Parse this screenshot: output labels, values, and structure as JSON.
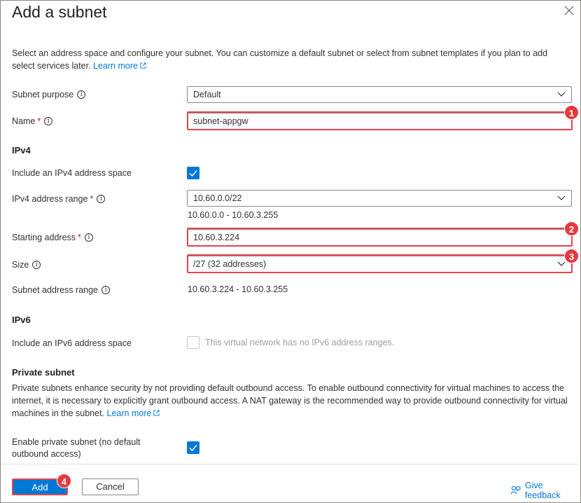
{
  "dialog": {
    "title": "Add a subnet",
    "description": "Select an address space and configure your subnet. You can customize a default subnet or select from subnet templates if you plan to add select services later.",
    "learn_more": "Learn more"
  },
  "form": {
    "subnet_purpose": {
      "label": "Subnet purpose",
      "value": "Default"
    },
    "name": {
      "label": "Name",
      "required_mark": "*",
      "value": "subnet-appgw"
    },
    "ipv4_section": "IPv4",
    "include_ipv4": {
      "label": "Include an IPv4 address space",
      "checked": true
    },
    "ipv4_range": {
      "label": "IPv4 address range",
      "required_mark": "*",
      "value": "10.60.0.0/22",
      "range_text": "10.60.0.0 - 10.60.3.255"
    },
    "starting_address": {
      "label": "Starting address",
      "required_mark": "*",
      "value": "10.60.3.224"
    },
    "size": {
      "label": "Size",
      "value": "/27 (32 addresses)"
    },
    "subnet_address_range": {
      "label": "Subnet address range",
      "value": "10.60.3.224 - 10.60.3.255"
    },
    "ipv6_section": "IPv6",
    "include_ipv6": {
      "label": "Include an IPv6 address space",
      "checked": false,
      "disabled_text": "This virtual network has no IPv6 address ranges."
    },
    "private_section": "Private subnet",
    "private_description": "Private subnets enhance security by not providing default outbound access. To enable outbound connectivity for virtual machines to access the internet, it is necessary to explicitly grant outbound access. A NAT gateway is the recommended way to provide outbound connectivity for virtual machines in the subnet.",
    "private_learn_more": "Learn more",
    "enable_private": {
      "label_line1": "Enable private subnet (no default",
      "label_line2": "outbound access)",
      "checked": true
    }
  },
  "annotations": {
    "badge1": "1",
    "badge2": "2",
    "badge3": "3",
    "badge4": "4"
  },
  "footer": {
    "add_label": "Add",
    "cancel_label": "Cancel",
    "feedback_label": "Give feedback"
  },
  "icons": {
    "info": "info-icon",
    "close": "close-icon",
    "chevron": "chevron-down-icon",
    "check": "checkmark-icon",
    "external": "external-link-icon",
    "feedback": "feedback-icon"
  },
  "colors": {
    "accent": "#0078d4",
    "highlight": "#e8424c",
    "badge": "#e5393f"
  }
}
